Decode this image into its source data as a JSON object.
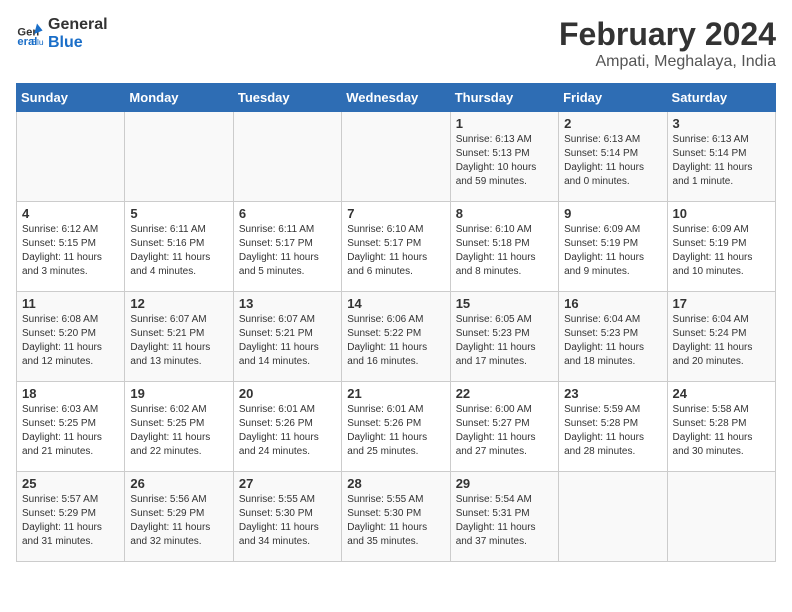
{
  "logo": {
    "line1": "General",
    "line2": "Blue"
  },
  "title": "February 2024",
  "subtitle": "Ampati, Meghalaya, India",
  "days_of_week": [
    "Sunday",
    "Monday",
    "Tuesday",
    "Wednesday",
    "Thursday",
    "Friday",
    "Saturday"
  ],
  "weeks": [
    [
      {
        "num": "",
        "info": ""
      },
      {
        "num": "",
        "info": ""
      },
      {
        "num": "",
        "info": ""
      },
      {
        "num": "",
        "info": ""
      },
      {
        "num": "1",
        "info": "Sunrise: 6:13 AM\nSunset: 5:13 PM\nDaylight: 10 hours and 59 minutes."
      },
      {
        "num": "2",
        "info": "Sunrise: 6:13 AM\nSunset: 5:14 PM\nDaylight: 11 hours and 0 minutes."
      },
      {
        "num": "3",
        "info": "Sunrise: 6:13 AM\nSunset: 5:14 PM\nDaylight: 11 hours and 1 minute."
      }
    ],
    [
      {
        "num": "4",
        "info": "Sunrise: 6:12 AM\nSunset: 5:15 PM\nDaylight: 11 hours and 3 minutes."
      },
      {
        "num": "5",
        "info": "Sunrise: 6:11 AM\nSunset: 5:16 PM\nDaylight: 11 hours and 4 minutes."
      },
      {
        "num": "6",
        "info": "Sunrise: 6:11 AM\nSunset: 5:17 PM\nDaylight: 11 hours and 5 minutes."
      },
      {
        "num": "7",
        "info": "Sunrise: 6:10 AM\nSunset: 5:17 PM\nDaylight: 11 hours and 6 minutes."
      },
      {
        "num": "8",
        "info": "Sunrise: 6:10 AM\nSunset: 5:18 PM\nDaylight: 11 hours and 8 minutes."
      },
      {
        "num": "9",
        "info": "Sunrise: 6:09 AM\nSunset: 5:19 PM\nDaylight: 11 hours and 9 minutes."
      },
      {
        "num": "10",
        "info": "Sunrise: 6:09 AM\nSunset: 5:19 PM\nDaylight: 11 hours and 10 minutes."
      }
    ],
    [
      {
        "num": "11",
        "info": "Sunrise: 6:08 AM\nSunset: 5:20 PM\nDaylight: 11 hours and 12 minutes."
      },
      {
        "num": "12",
        "info": "Sunrise: 6:07 AM\nSunset: 5:21 PM\nDaylight: 11 hours and 13 minutes."
      },
      {
        "num": "13",
        "info": "Sunrise: 6:07 AM\nSunset: 5:21 PM\nDaylight: 11 hours and 14 minutes."
      },
      {
        "num": "14",
        "info": "Sunrise: 6:06 AM\nSunset: 5:22 PM\nDaylight: 11 hours and 16 minutes."
      },
      {
        "num": "15",
        "info": "Sunrise: 6:05 AM\nSunset: 5:23 PM\nDaylight: 11 hours and 17 minutes."
      },
      {
        "num": "16",
        "info": "Sunrise: 6:04 AM\nSunset: 5:23 PM\nDaylight: 11 hours and 18 minutes."
      },
      {
        "num": "17",
        "info": "Sunrise: 6:04 AM\nSunset: 5:24 PM\nDaylight: 11 hours and 20 minutes."
      }
    ],
    [
      {
        "num": "18",
        "info": "Sunrise: 6:03 AM\nSunset: 5:25 PM\nDaylight: 11 hours and 21 minutes."
      },
      {
        "num": "19",
        "info": "Sunrise: 6:02 AM\nSunset: 5:25 PM\nDaylight: 11 hours and 22 minutes."
      },
      {
        "num": "20",
        "info": "Sunrise: 6:01 AM\nSunset: 5:26 PM\nDaylight: 11 hours and 24 minutes."
      },
      {
        "num": "21",
        "info": "Sunrise: 6:01 AM\nSunset: 5:26 PM\nDaylight: 11 hours and 25 minutes."
      },
      {
        "num": "22",
        "info": "Sunrise: 6:00 AM\nSunset: 5:27 PM\nDaylight: 11 hours and 27 minutes."
      },
      {
        "num": "23",
        "info": "Sunrise: 5:59 AM\nSunset: 5:28 PM\nDaylight: 11 hours and 28 minutes."
      },
      {
        "num": "24",
        "info": "Sunrise: 5:58 AM\nSunset: 5:28 PM\nDaylight: 11 hours and 30 minutes."
      }
    ],
    [
      {
        "num": "25",
        "info": "Sunrise: 5:57 AM\nSunset: 5:29 PM\nDaylight: 11 hours and 31 minutes."
      },
      {
        "num": "26",
        "info": "Sunrise: 5:56 AM\nSunset: 5:29 PM\nDaylight: 11 hours and 32 minutes."
      },
      {
        "num": "27",
        "info": "Sunrise: 5:55 AM\nSunset: 5:30 PM\nDaylight: 11 hours and 34 minutes."
      },
      {
        "num": "28",
        "info": "Sunrise: 5:55 AM\nSunset: 5:30 PM\nDaylight: 11 hours and 35 minutes."
      },
      {
        "num": "29",
        "info": "Sunrise: 5:54 AM\nSunset: 5:31 PM\nDaylight: 11 hours and 37 minutes."
      },
      {
        "num": "",
        "info": ""
      },
      {
        "num": "",
        "info": ""
      }
    ]
  ]
}
